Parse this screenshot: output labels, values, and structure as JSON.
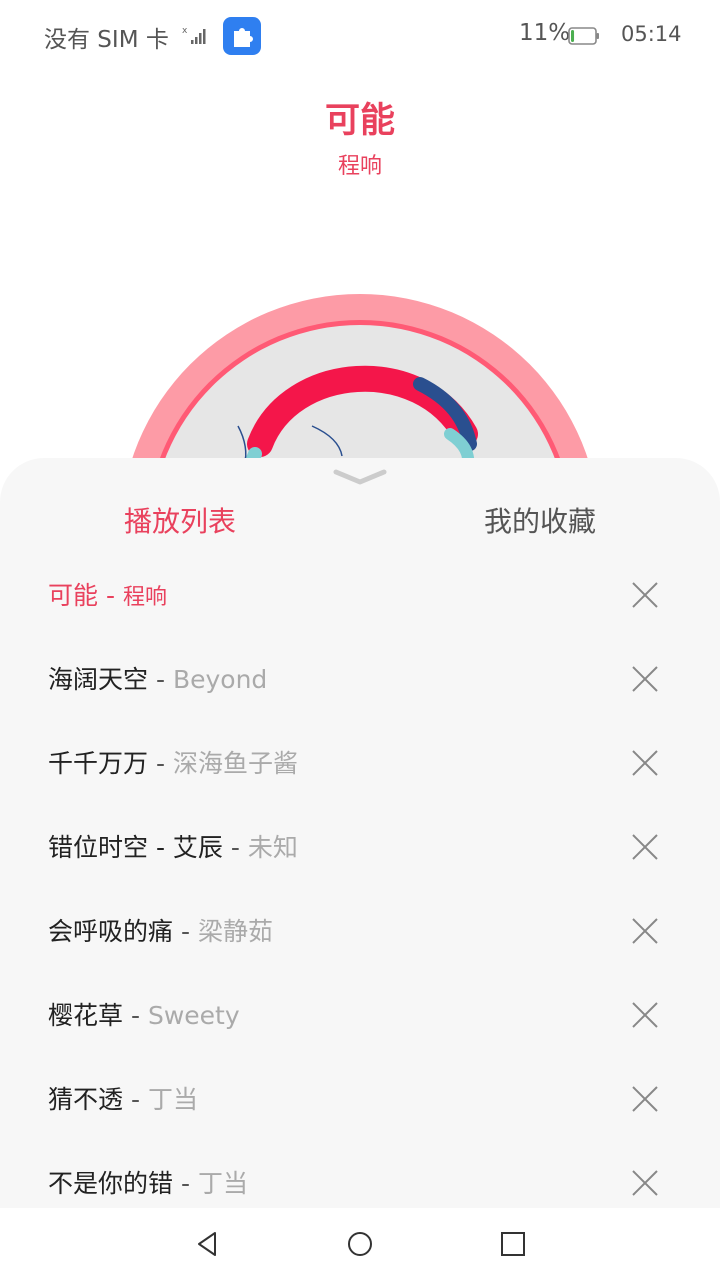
{
  "status_bar": {
    "carrier": "没有 SIM 卡",
    "signal_icon": "signal-no-sim-icon",
    "app_icon": "puzzle-icon",
    "battery_percent": "11%",
    "battery_level": 0.11,
    "battery_color": "#4caf50",
    "time": "05:14"
  },
  "now_playing": {
    "title": "可能",
    "artist": "程响"
  },
  "colors": {
    "accent": "#e9415d",
    "disc_ring": "#fd9ba6",
    "sheet_bg": "#f7f7f7"
  },
  "playlist": {
    "tabs": [
      "播放列表",
      "我的收藏"
    ],
    "active_tab": 0,
    "tracks": [
      {
        "name": "可能",
        "meta": "程响",
        "active": true
      },
      {
        "name": "海阔天空",
        "meta": "Beyond"
      },
      {
        "name": "千千万万",
        "meta": "深海鱼子酱"
      },
      {
        "name": "错位时空 - 艾辰",
        "meta": "未知"
      },
      {
        "name": "会呼吸的痛",
        "meta": "梁静茹"
      },
      {
        "name": "樱花草",
        "meta": "Sweety"
      },
      {
        "name": "猜不透",
        "meta": "丁当"
      },
      {
        "name": "不是你的错",
        "meta": "丁当"
      }
    ],
    "separator": "-"
  },
  "nav_bar": {
    "back_icon": "back-triangle-icon",
    "home_icon": "home-circle-icon",
    "recents_icon": "recents-square-icon"
  }
}
